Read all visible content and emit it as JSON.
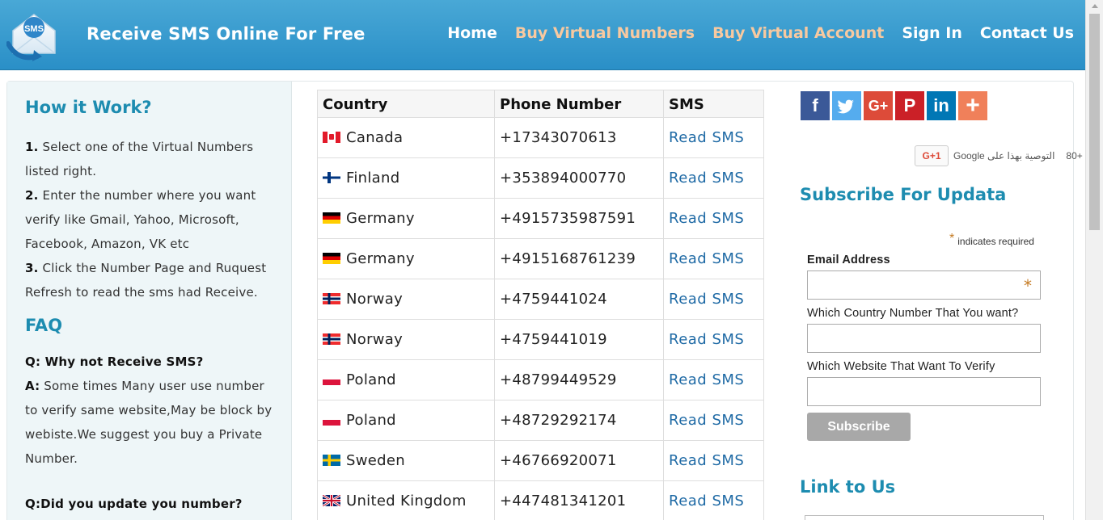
{
  "header": {
    "logo_text": "SMS",
    "title": "Receive SMS Online For Free",
    "nav": [
      {
        "label": "Home",
        "style": "white"
      },
      {
        "label": "Buy Virtual Numbers",
        "style": "orange"
      },
      {
        "label": "Buy Virtual Account",
        "style": "orange"
      },
      {
        "label": "Sign In",
        "style": "white"
      },
      {
        "label": "Contact Us",
        "style": "white"
      }
    ]
  },
  "left": {
    "how_title": "How it Work?",
    "steps": [
      {
        "num": "1.",
        "text": " Select one of the Virtual Numbers listed right."
      },
      {
        "num": "2.",
        "text": " Enter the number where you want verify like Gmail, Yahoo, Microsoft, Facebook, Amazon, VK etc"
      },
      {
        "num": "3.",
        "text": " Click the Number Page and Ruquest Refresh to read the sms had Receive."
      }
    ],
    "faq_title": "FAQ",
    "faq": [
      {
        "q": "Q: Why not Receive SMS?",
        "a_label": "A:",
        "a": " Some times Many user use number to verify same website,May be block by webiste.We suggest you buy a Private Number."
      },
      {
        "q": "Q:Did you update you number?",
        "a_label": "",
        "a": ""
      }
    ]
  },
  "table": {
    "headers": [
      "Country",
      "Phone Number",
      "SMS"
    ],
    "rows": [
      {
        "country": "Canada",
        "flag": "canada-flag-icon",
        "phone": "+17343070613",
        "sms": "Read SMS"
      },
      {
        "country": "Finland",
        "flag": "finland-flag-icon",
        "phone": "+353894000770",
        "sms": "Read SMS"
      },
      {
        "country": "Germany",
        "flag": "germany-flag-icon",
        "phone": "+4915735987591",
        "sms": "Read SMS"
      },
      {
        "country": "Germany",
        "flag": "germany-flag-icon",
        "phone": "+4915168761239",
        "sms": "Read SMS"
      },
      {
        "country": "Norway",
        "flag": "norway-flag-icon",
        "phone": "+4759441024",
        "sms": "Read SMS"
      },
      {
        "country": "Norway",
        "flag": "norway-flag-icon",
        "phone": "+4759441019",
        "sms": "Read SMS"
      },
      {
        "country": "Poland",
        "flag": "poland-flag-icon",
        "phone": "+48799449529",
        "sms": "Read SMS"
      },
      {
        "country": "Poland",
        "flag": "poland-flag-icon",
        "phone": "+48729292174",
        "sms": "Read SMS"
      },
      {
        "country": "Sweden",
        "flag": "sweden-flag-icon",
        "phone": "+46766920071",
        "sms": "Read SMS"
      },
      {
        "country": "United Kingdom",
        "flag": "uk-flag-icon",
        "phone": "+447481341201",
        "sms": "Read SMS"
      }
    ]
  },
  "right": {
    "social": [
      {
        "name": "facebook-icon",
        "glyph": "f",
        "color": "#3b5998"
      },
      {
        "name": "twitter-icon",
        "glyph": "t",
        "color": "#55acee"
      },
      {
        "name": "google-plus-icon",
        "glyph": "G+",
        "color": "#dd4b39"
      },
      {
        "name": "pinterest-icon",
        "glyph": "P",
        "color": "#cb2027"
      },
      {
        "name": "linkedin-icon",
        "glyph": "in",
        "color": "#0077b5"
      },
      {
        "name": "share-more-icon",
        "glyph": "+",
        "color": "#f0805a"
      }
    ],
    "gplus_button": "G+1",
    "gplus_text": "التوصية بهذا على Google",
    "gplus_count": "80+",
    "subscribe_title": "Subscribe For Updata",
    "required_note": "indicates required",
    "email_label": "Email Address",
    "country_label": "Which Country Number That You want?",
    "website_label": "Which Website That Want To Verify",
    "subscribe_button": "Subscribe",
    "link_title": "Link to Us"
  },
  "colors": {
    "header_blue": "#2a8fc7",
    "accent_teal": "#1d8cb0",
    "nav_orange": "#f8c9a0",
    "link_blue": "#1f6aa5"
  }
}
